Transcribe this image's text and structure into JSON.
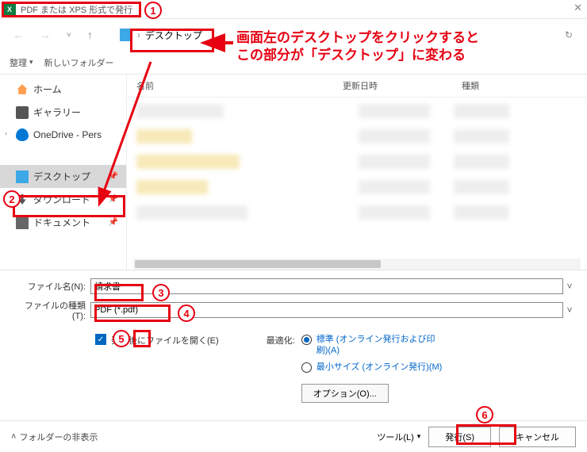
{
  "window": {
    "title": "PDF または XPS 形式で発行",
    "app_icon_letter": "X"
  },
  "nav": {
    "breadcrumb_location": "デスクトップ"
  },
  "toolbar": {
    "organize": "整理",
    "new_folder": "新しいフォルダー"
  },
  "sidebar": {
    "items": [
      {
        "label": "ホーム",
        "icon": "home"
      },
      {
        "label": "ギャラリー",
        "icon": "gallery"
      },
      {
        "label": "OneDrive - Pers",
        "icon": "cloud",
        "expandable": true
      },
      {
        "label": "デスクトップ",
        "icon": "desktop",
        "selected": true,
        "pinned": true
      },
      {
        "label": "ダウンロード",
        "icon": "download",
        "pinned": true
      },
      {
        "label": "ドキュメント",
        "icon": "document",
        "pinned": true
      }
    ]
  },
  "columns": {
    "name": "名前",
    "date": "更新日時",
    "type": "種類"
  },
  "form": {
    "filename_label": "ファイル名(N):",
    "filename_value": "請求書",
    "filetype_label": "ファイルの種類(T):",
    "filetype_value": "PDF (*.pdf)"
  },
  "options": {
    "open_after_label": "発行後にファイルを開く(E)",
    "open_after_checked": true,
    "optimize_label": "最適化:",
    "radio_standard": "標準 (オンライン発行および印刷)(A)",
    "radio_min": "最小サイズ (オンライン発行)(M)",
    "options_button": "オプション(O)..."
  },
  "footer": {
    "hide_folders": "フォルダーの非表示",
    "tools": "ツール(L)",
    "publish": "発行(S)",
    "cancel": "キャンセル"
  },
  "annotations": {
    "n1": "1",
    "n2": "2",
    "n3": "3",
    "n4": "4",
    "n5": "5",
    "n6": "6",
    "note_line1": "画面左のデスクトップをクリックすると",
    "note_line2": "この部分が「デスクトップ」に変わる"
  }
}
